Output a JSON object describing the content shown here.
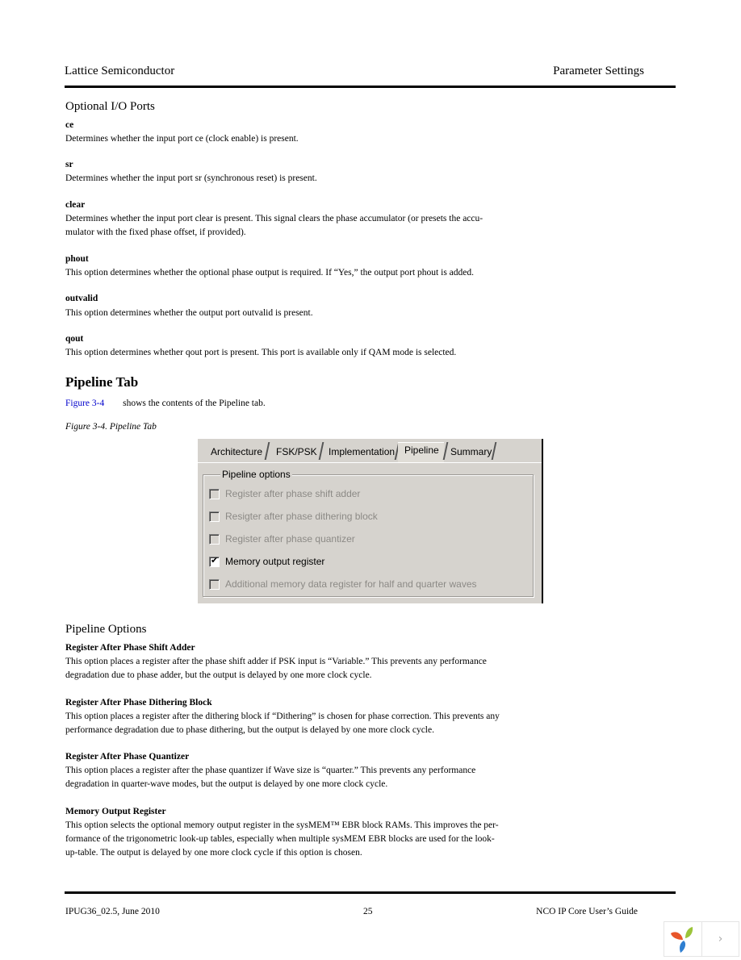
{
  "header": {
    "left": "Lattice Semiconductor",
    "right": "Parameter Settings"
  },
  "optional_io": {
    "title": "Optional I/O Ports",
    "items": [
      {
        "term": "ce",
        "desc": "Determines whether the input port ce (clock enable) is present."
      },
      {
        "term": "sr",
        "desc": "Determines whether the input port sr (synchronous reset) is present."
      },
      {
        "term": "clear",
        "desc_line1": "Determines whether the input port clear is present. This signal clears the phase accumulator (or presets the accu-",
        "desc_line2": "mulator with the fixed phase offset, if provided)."
      },
      {
        "term": "phout",
        "desc": "This option determines whether the optional phase output is required. If “Yes,” the output port phout is added."
      },
      {
        "term": "outvalid",
        "desc": "This option determines whether the output port outvalid is present."
      },
      {
        "term": "qout",
        "desc": "This option determines whether qout port is present. This port is available only if QAM mode is selected."
      }
    ]
  },
  "pipeline_tab": {
    "title": "Pipeline Tab",
    "ref_link": "Figure 3-4",
    "ref_text": "shows the contents of the Pipeline tab.",
    "caption": "Figure 3-4. Pipeline Tab"
  },
  "dialog": {
    "tabs": [
      {
        "label": "Architecture",
        "active": false
      },
      {
        "label": "FSK/PSK",
        "active": false
      },
      {
        "label": "Implementation",
        "active": false
      },
      {
        "label": "Pipeline",
        "active": true
      },
      {
        "label": "Summary",
        "active": false
      }
    ],
    "group_label": "Pipeline options",
    "options": [
      {
        "label": "Register after phase shift adder",
        "checked": false,
        "enabled": false
      },
      {
        "label": "Resigter after phase dithering block",
        "checked": false,
        "enabled": false
      },
      {
        "label": "Register after phase quantizer",
        "checked": false,
        "enabled": false
      },
      {
        "label": "Memory output register",
        "checked": true,
        "enabled": true
      },
      {
        "label": "Additional memory data register for half and quarter waves",
        "checked": false,
        "enabled": false
      }
    ],
    "check_glyph": "✔"
  },
  "pipeline_options": {
    "title": "Pipeline Options",
    "items": [
      {
        "term": "Register After Phase Shift Adder",
        "line1": "This option places a register after the phase shift adder if PSK input is “Variable.” This prevents any performance",
        "line2": "degradation due to phase adder, but the output is delayed by one more clock cycle."
      },
      {
        "term": "Register After Phase Dithering Block",
        "line1": "This option places a register after the dithering block if “Dithering” is chosen for phase correction. This prevents any",
        "line2": "performance degradation due to phase dithering, but the output is delayed by one more clock cycle."
      },
      {
        "term": "Register After Phase Quantizer",
        "line1": "This option places a register after the phase quantizer if Wave size is “quarter.” This prevents any performance",
        "line2": "degradation in quarter-wave modes, but the output is delayed by one more clock cycle."
      },
      {
        "term": "Memory Output Register",
        "line1": "This option selects the optional memory output register in the sysMEM™ EBR block RAMs. This improves the per-",
        "line2": "formance of the trigonometric look-up tables, especially when multiple sysMEM EBR blocks are used for the look-",
        "line3": "up-table. The output is delayed by one more clock cycle if this option is chosen."
      }
    ]
  },
  "footer": {
    "left": "IPUG36_02.5, June 2010",
    "center": "25",
    "right": "NCO IP Core User’s Guide"
  },
  "widget": {
    "next_glyph": "›"
  }
}
